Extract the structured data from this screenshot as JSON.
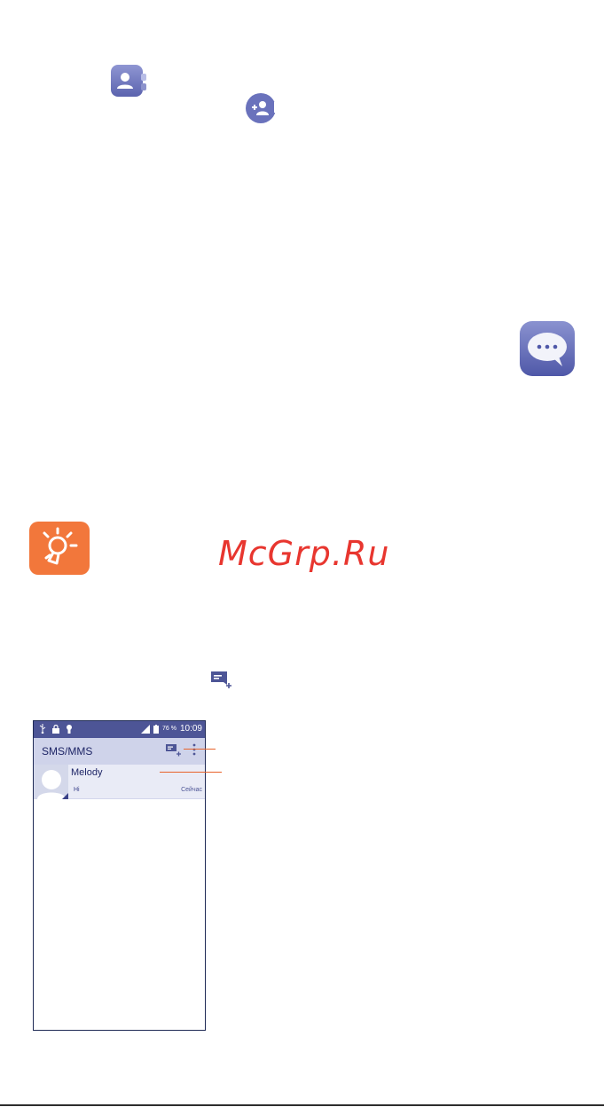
{
  "colors": {
    "accent": "#4d5596",
    "tip": "#f2773b",
    "callout": "#e8632b",
    "watermark": "#e8362f"
  },
  "icons": {
    "contacts_app": "contacts-app-icon",
    "add_contact": "add-contact-icon",
    "messaging_app": "messaging-app-icon",
    "tip": "lightbulb-icon",
    "new_message": "new-message-icon"
  },
  "watermark": {
    "text": "McGrp.Ru"
  },
  "screenshot": {
    "status_bar": {
      "battery": "76 %",
      "time": "10:09"
    },
    "app_bar": {
      "title": "SMS/MMS"
    },
    "conversations": [
      {
        "name": "Melody",
        "snippet": "Hi",
        "time": "Сейчас"
      }
    ]
  }
}
